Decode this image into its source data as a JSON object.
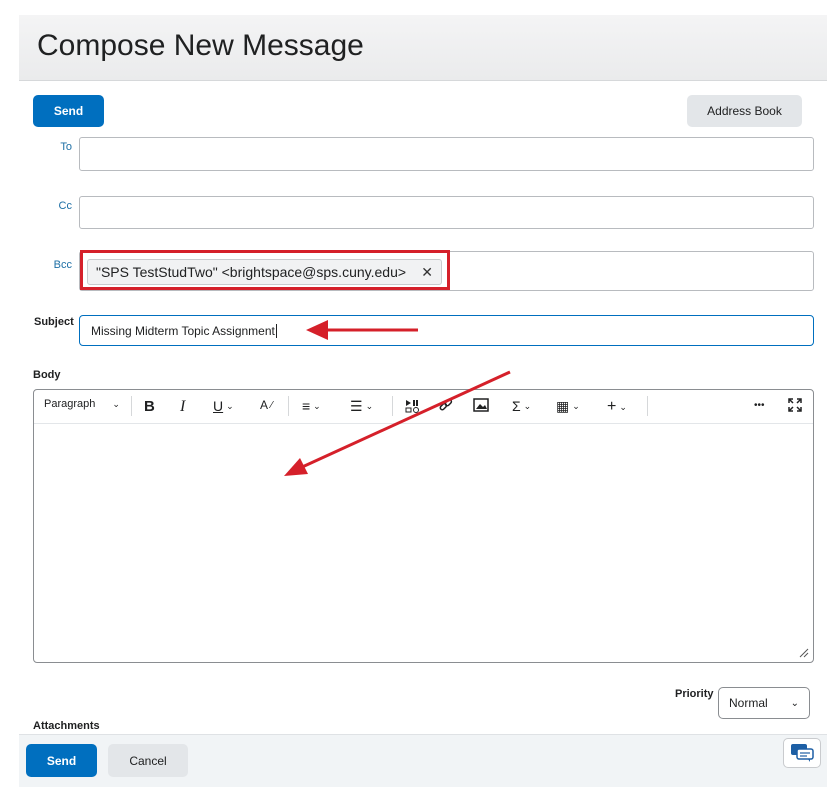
{
  "page": {
    "title": "Compose New Message"
  },
  "top_actions": {
    "send_label": "Send",
    "address_book_label": "Address Book"
  },
  "fields": {
    "to_label": "To",
    "to_value": "",
    "cc_label": "Cc",
    "cc_value": "",
    "bcc_label": "Bcc",
    "bcc_recipient": "\"SPS TestStudTwo\" <brightspace@sps.cuny.edu>",
    "remove_glyph": "✕",
    "subject_label": "Subject",
    "subject_value": "Missing Midterm Topic Assignment",
    "body_label": "Body"
  },
  "editor": {
    "block_format": "Paragraph",
    "tools": [
      "bold",
      "italic",
      "underline",
      "text-style",
      "align",
      "list",
      "media",
      "link",
      "image",
      "equation",
      "table",
      "insert",
      "more",
      "fullscreen"
    ],
    "glyphs": {
      "bold": "B",
      "italic": "I",
      "underline": "U",
      "spell": "A",
      "align": "≡",
      "list": "☰",
      "sigma": "Σ",
      "table": "▦",
      "plus": "+",
      "more": "•••",
      "caret": "⌄"
    }
  },
  "priority": {
    "label": "Priority",
    "selected": "Normal"
  },
  "attachments": {
    "label": "Attachments"
  },
  "footer": {
    "send_label": "Send",
    "cancel_label": "Cancel"
  },
  "annotations": {
    "color": "#d5202a"
  },
  "colors": {
    "primary": "#006fbf",
    "secondary_bg": "#e3e6e9",
    "link": "#1d6fa5"
  }
}
